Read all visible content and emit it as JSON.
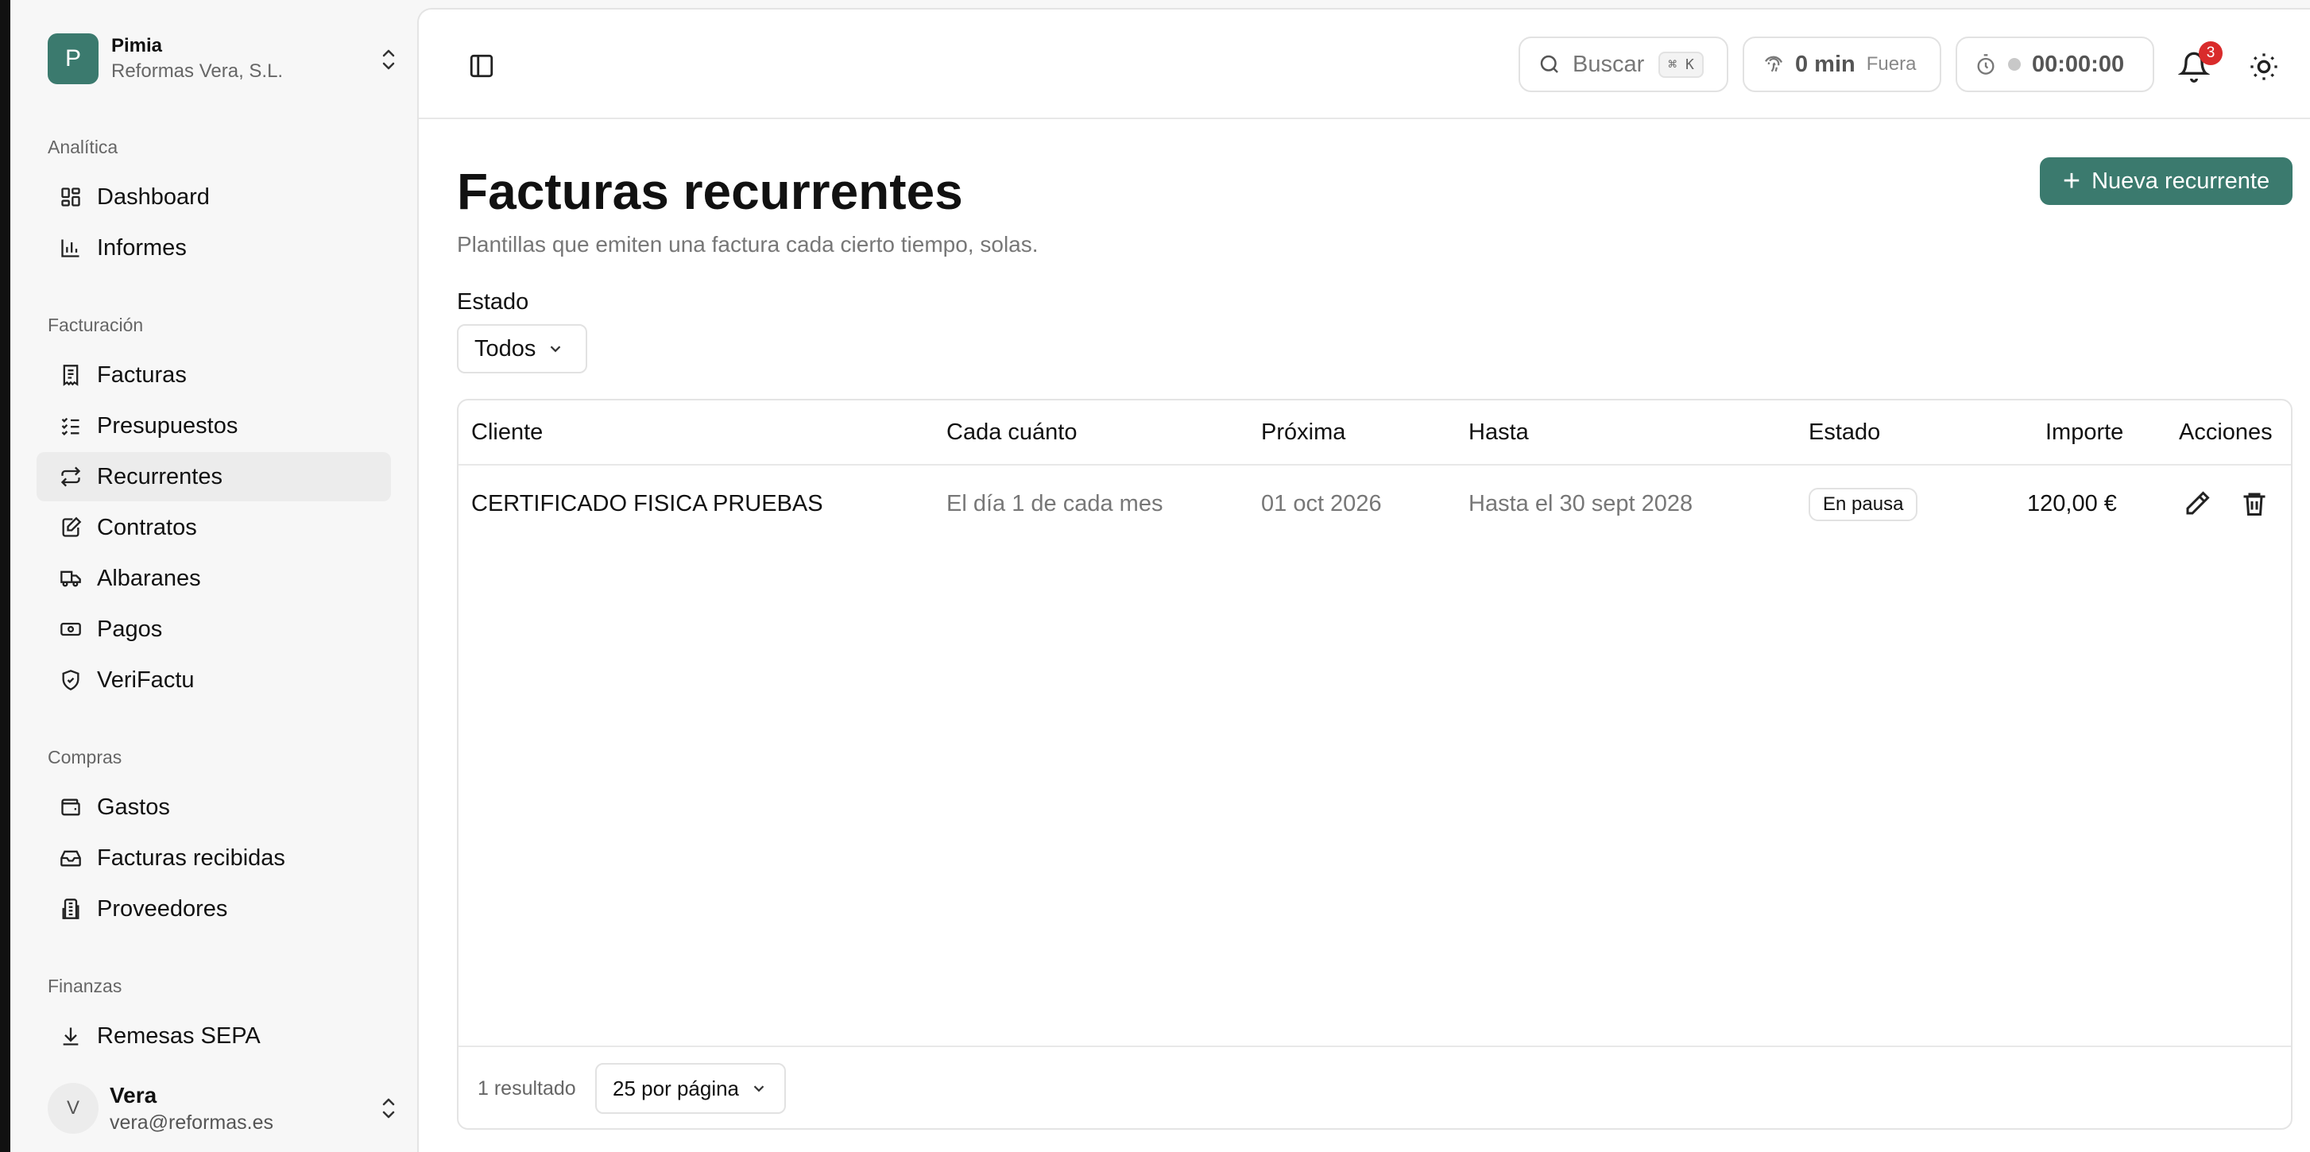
{
  "org": {
    "initial": "P",
    "name": "Pimia",
    "subtitle": "Reformas Vera, S.L."
  },
  "sidebar": {
    "sections": [
      {
        "label": "Analítica",
        "items": [
          {
            "label": "Dashboard",
            "icon": "dashboard-icon"
          },
          {
            "label": "Informes",
            "icon": "bar-chart-icon"
          }
        ]
      },
      {
        "label": "Facturación",
        "items": [
          {
            "label": "Facturas",
            "icon": "invoice-icon"
          },
          {
            "label": "Presupuestos",
            "icon": "checklist-icon"
          },
          {
            "label": "Recurrentes",
            "icon": "repeat-icon",
            "active": true
          },
          {
            "label": "Contratos",
            "icon": "contract-icon"
          },
          {
            "label": "Albaranes",
            "icon": "truck-icon"
          },
          {
            "label": "Pagos",
            "icon": "banknote-icon"
          },
          {
            "label": "VeriFactu",
            "icon": "shield-check-icon"
          }
        ]
      },
      {
        "label": "Compras",
        "items": [
          {
            "label": "Gastos",
            "icon": "wallet-icon"
          },
          {
            "label": "Facturas recibidas",
            "icon": "inbox-icon"
          },
          {
            "label": "Proveedores",
            "icon": "building-icon"
          }
        ]
      },
      {
        "label": "Finanzas",
        "items": [
          {
            "label": "Remesas SEPA",
            "icon": "download-icon"
          }
        ]
      }
    ]
  },
  "user": {
    "initial": "V",
    "name": "Vera",
    "email": "vera@reformas.es"
  },
  "topbar": {
    "search_label": "Buscar",
    "search_shortcut": "⌘ K",
    "presence_value": "0 min",
    "presence_status": "Fuera",
    "timer_value": "00:00:00",
    "notifications_count": "3"
  },
  "page": {
    "title": "Facturas recurrentes",
    "subtitle": "Plantillas que emiten una factura cada cierto tiempo, solas.",
    "new_button": "Nueva recurrente",
    "filter_label": "Estado",
    "filter_value": "Todos"
  },
  "table": {
    "headers": {
      "cliente": "Cliente",
      "frecuencia": "Cada cuánto",
      "proxima": "Próxima",
      "hasta": "Hasta",
      "estado": "Estado",
      "importe": "Importe",
      "acciones": "Acciones"
    },
    "rows": [
      {
        "cliente": "CERTIFICADO FISICA PRUEBAS",
        "frecuencia": "El día 1 de cada mes",
        "proxima": "01 oct 2026",
        "hasta": "Hasta el 30 sept 2028",
        "estado": "En pausa",
        "importe": "120,00 €"
      }
    ],
    "result_count": "1 resultado",
    "per_page": "25 por página"
  },
  "colors": {
    "accent": "#3b7a6e",
    "badge": "#d92b2b"
  }
}
